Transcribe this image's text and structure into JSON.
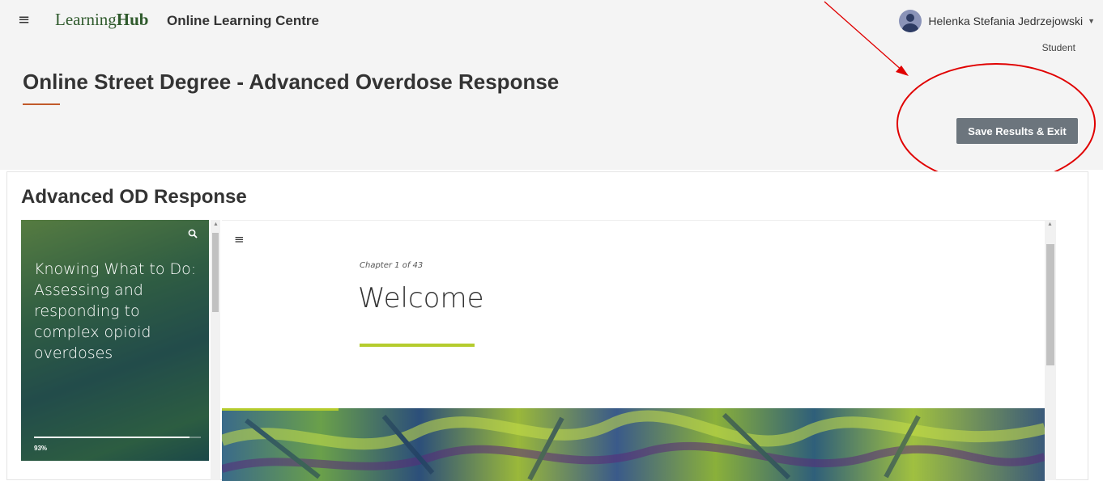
{
  "header": {
    "menu_icon": "hamburger-icon",
    "logo_light": "Learning",
    "logo_bold": "Hub",
    "subtitle": "Online Learning Centre",
    "user_name": "Helenka Stefania Jedrzejowski",
    "user_role": "Student"
  },
  "page": {
    "title": "Online Street Degree - Advanced Overdose Response",
    "save_button": "Save Results & Exit"
  },
  "course": {
    "title": "Advanced OD Response",
    "side_title": "Knowing What to Do: Assessing and responding to complex opioid overdoses",
    "progress_label": "93%",
    "progress_value": 0.93,
    "chapter_label": "Chapter 1 of 43",
    "chapter_title": "Welcome"
  },
  "colors": {
    "annotation": "#e00000",
    "accent": "#b5cc2d",
    "title_rule": "#c15a2a",
    "button": "#6c757d"
  }
}
